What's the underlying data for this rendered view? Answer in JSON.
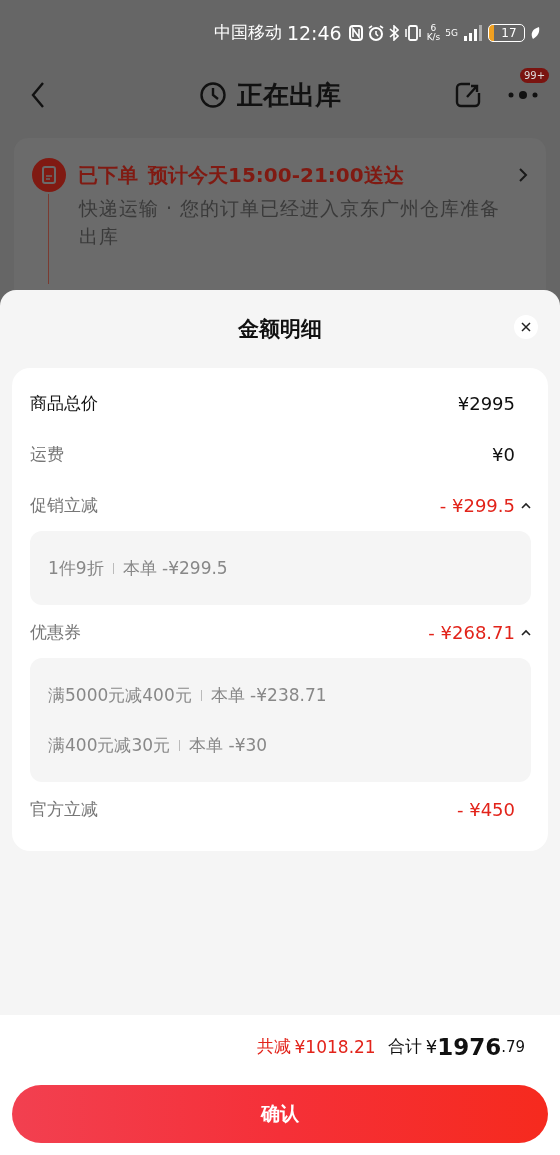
{
  "status_bar": {
    "carrier": "中国移动",
    "time": "12:46",
    "speed_value": "6",
    "speed_unit": "K/s",
    "network": "5G",
    "battery": "17"
  },
  "nav": {
    "title": "正在出库",
    "badge": "99+"
  },
  "order_card": {
    "status": "已下单",
    "eta": "预计今天15:00-21:00送达",
    "description": "快递运输 · 您的订单已经进入京东广州仓库准备出库"
  },
  "sheet": {
    "title": "金额明细",
    "rows": [
      {
        "kind": "total",
        "label": "商品总价",
        "amount": "¥2995",
        "expanded": false
      },
      {
        "kind": "fee",
        "label": "运费",
        "amount": "¥0",
        "expanded": false
      },
      {
        "kind": "discount",
        "label": "促销立减",
        "amount": "- ¥299.5",
        "expanded": true,
        "details": [
          {
            "name": "1件9折",
            "value": "本单 -¥299.5"
          }
        ]
      },
      {
        "kind": "discount",
        "label": "优惠券",
        "amount": "- ¥268.71",
        "expanded": true,
        "details": [
          {
            "name": "满5000元减400元",
            "value": "本单 -¥238.71"
          },
          {
            "name": "满400元减30元",
            "value": "本单 -¥30"
          }
        ]
      },
      {
        "kind": "discount",
        "label": "官方立减",
        "amount": "- ¥450",
        "expanded": false
      }
    ]
  },
  "footer": {
    "saved_label": "共减",
    "saved_amount": "¥1018.21",
    "total_label": "合计",
    "total_currency": "¥",
    "total_integer": "1976",
    "total_decimal": ".79",
    "confirm_button": "确认"
  }
}
